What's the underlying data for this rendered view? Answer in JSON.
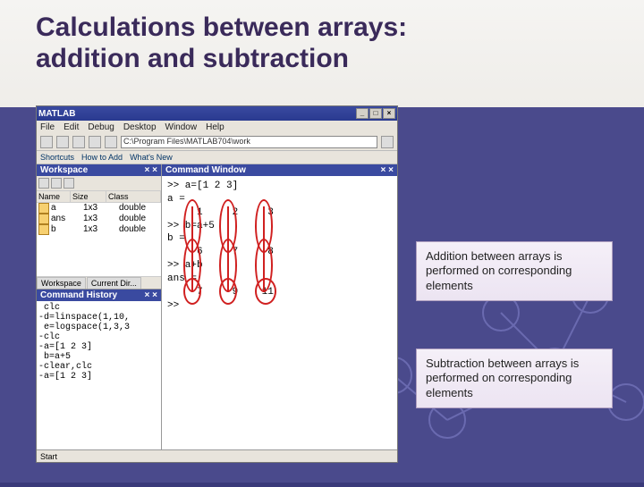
{
  "slide": {
    "title_line1": "Calculations between arrays:",
    "title_line2": "addition and subtraction"
  },
  "app": {
    "title": "MATLAB",
    "menus": [
      "File",
      "Edit",
      "Debug",
      "Desktop",
      "Window",
      "Help"
    ],
    "currentDir": "C:\\Program Files\\MATLAB704\\work",
    "shortcuts": [
      "Shortcuts",
      "How to Add",
      "What's New"
    ]
  },
  "workspace": {
    "title": "Workspace",
    "cols": [
      "Name",
      "Size",
      "Class"
    ],
    "rows": [
      {
        "name": "a",
        "size": "1x3",
        "class": "double"
      },
      {
        "name": "ans",
        "size": "1x3",
        "class": "double"
      },
      {
        "name": "b",
        "size": "1x3",
        "class": "double"
      }
    ],
    "tabs": [
      "Workspace",
      "Current Dir..."
    ]
  },
  "cmdhist": {
    "title": "Command History",
    "lines": [
      " clc",
      "-d=linspace(1,10,",
      " e=logspace(1,3,3",
      "-clc",
      "-a=[1 2 3]",
      " b=a+5",
      "-clear,clc",
      "-a=[1 2 3]"
    ]
  },
  "cmdwin": {
    "title": "Command Window",
    "lines": [
      ">> a=[1 2 3]",
      "a =",
      "     1     2     3",
      ">> b=a+5",
      "b =",
      "     6     7     8",
      ">> a+b",
      "ans =",
      "     7     9    11",
      ">> "
    ]
  },
  "status": {
    "text": "Start"
  },
  "annotations": {
    "addition": "Addition between arrays is performed on corresponding elements",
    "subtraction": "Subtraction between arrays is performed on corresponding elements"
  }
}
